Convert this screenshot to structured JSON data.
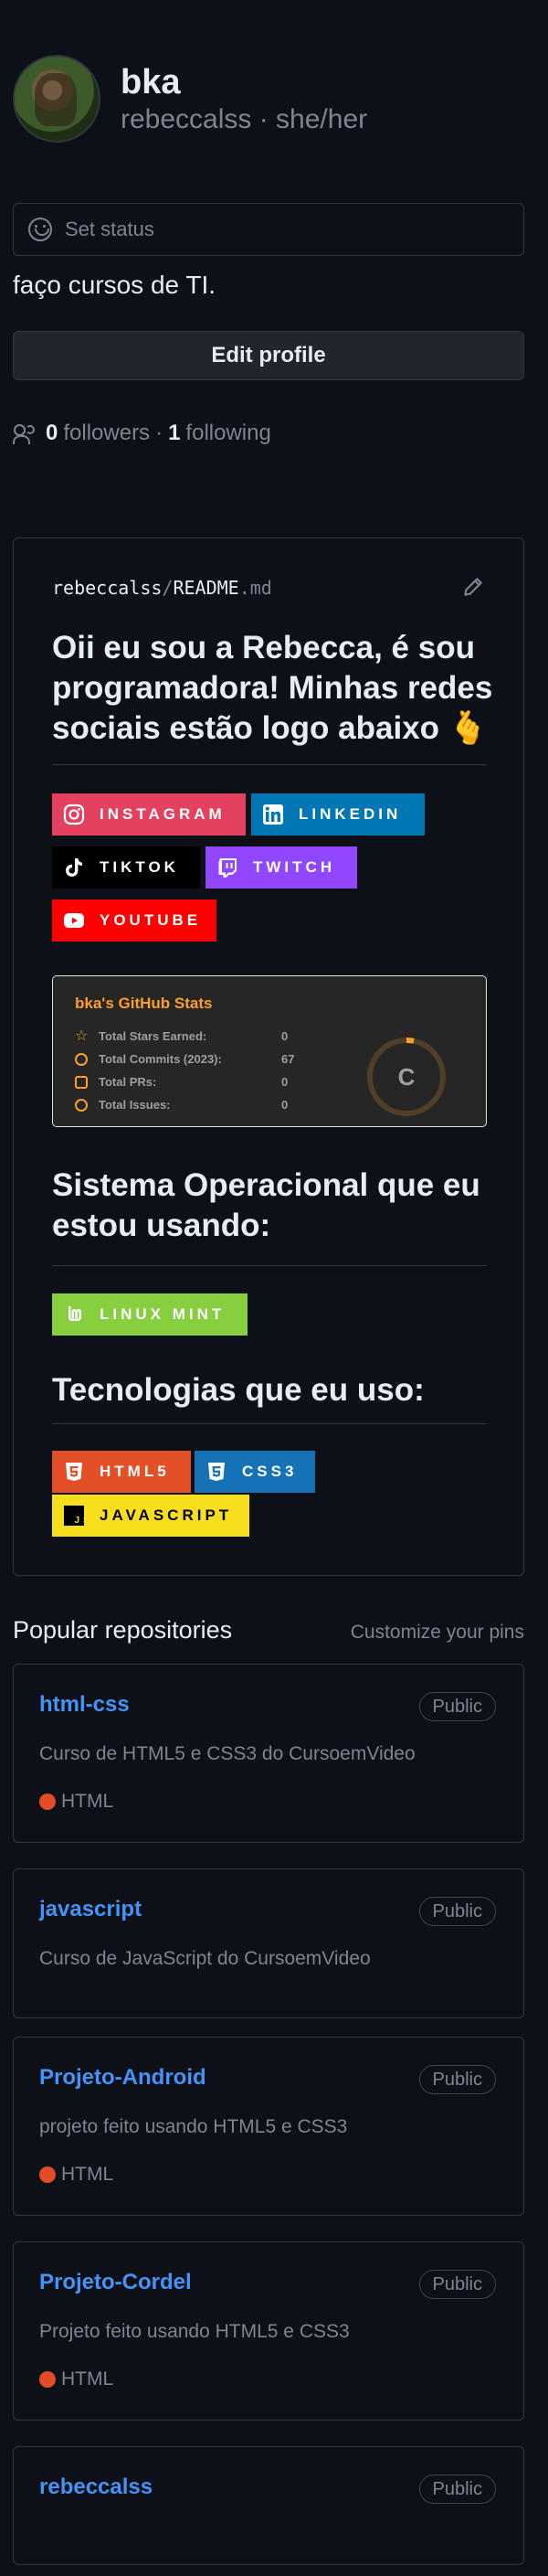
{
  "profile": {
    "display_name": "bka",
    "login_line": "rebeccalss · she/her",
    "status_placeholder": "Set status",
    "bio": "faço cursos de TI.",
    "edit_button": "Edit profile",
    "followers_count": "0",
    "followers_label": "followers",
    "separator": "·",
    "following_count": "1",
    "following_label": "following"
  },
  "readme": {
    "owner": "rebeccalss",
    "slash": "/",
    "file": "README",
    "ext": ".md",
    "heading": "Oii eu sou a Rebecca, é sou programadora! Minhas redes sociais estão logo abaixo 🫰",
    "social_badges": [
      {
        "label": "INSTAGRAM",
        "icon": "instagram-icon",
        "color": "#e4405f"
      },
      {
        "label": "LINKEDIN",
        "icon": "linkedin-icon",
        "color": "#0077b5"
      },
      {
        "label": "TIKTOK",
        "icon": "tiktok-icon",
        "color": "#000000"
      },
      {
        "label": "TWITCH",
        "icon": "twitch-icon",
        "color": "#9146ff"
      },
      {
        "label": "YOUTUBE",
        "icon": "youtube-icon",
        "color": "#ff0000"
      }
    ],
    "stats": {
      "title": "bka's GitHub Stats",
      "rows": [
        {
          "label": "Total Stars Earned:",
          "value": "0"
        },
        {
          "label": "Total Commits (2023):",
          "value": "67"
        },
        {
          "label": "Total PRs:",
          "value": "0"
        },
        {
          "label": "Total Issues:",
          "value": "0"
        }
      ],
      "rank": "C",
      "accent_color": "#fe9e2b"
    },
    "os_heading": "Sistema Operacional que eu estou usando:",
    "os_badge": {
      "label": "LINUX MINT",
      "icon": "linux-mint-icon",
      "color": "#87cf3e"
    },
    "tech_heading": "Tecnologias que eu uso:",
    "tech_badges": [
      {
        "label": "HTML5",
        "icon": "html5-icon",
        "color": "#e34f26",
        "text_color": "#ffffff"
      },
      {
        "label": "CSS3",
        "icon": "css3-icon",
        "color": "#1572b6",
        "text_color": "#ffffff"
      },
      {
        "label": "JAVASCRIPT",
        "icon": "js-icon",
        "color": "#f7df1e",
        "text_color": "#000000"
      }
    ]
  },
  "repos_section": {
    "title": "Popular repositories",
    "customize": "Customize your pins",
    "repos": [
      {
        "name": "html-css",
        "visibility": "Public",
        "description": "Curso de HTML5 e CSS3 do CursoemVideo",
        "language": "HTML",
        "language_color": "#e34c26"
      },
      {
        "name": "javascript",
        "visibility": "Public",
        "description": "Curso de JavaScript do CursoemVideo",
        "language": "",
        "language_color": ""
      },
      {
        "name": "Projeto-Android",
        "visibility": "Public",
        "description": "projeto feito usando HTML5 e CSS3",
        "language": "HTML",
        "language_color": "#e34c26"
      },
      {
        "name": "Projeto-Cordel",
        "visibility": "Public",
        "description": "Projeto feito usando HTML5 e CSS3",
        "language": "HTML",
        "language_color": "#e34c26"
      },
      {
        "name": "rebeccalss",
        "visibility": "Public",
        "description": "",
        "language": "",
        "language_color": ""
      }
    ]
  }
}
